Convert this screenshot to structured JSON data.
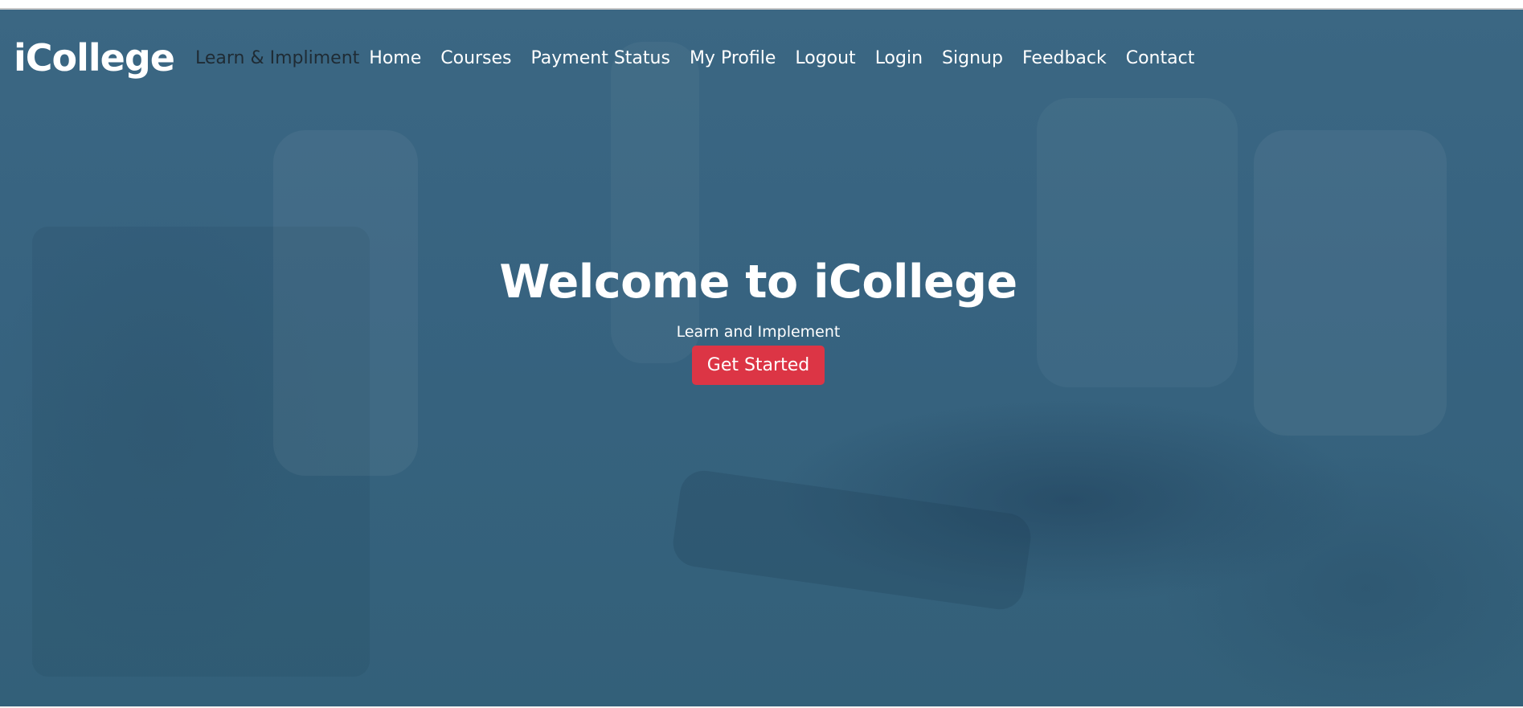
{
  "navbar": {
    "brand": "iCollege",
    "tagline": "Learn & Impliment",
    "links": [
      {
        "label": "Home"
      },
      {
        "label": "Courses"
      },
      {
        "label": "Payment Status"
      },
      {
        "label": "My Profile"
      },
      {
        "label": "Logout"
      },
      {
        "label": "Login"
      },
      {
        "label": "Signup"
      },
      {
        "label": "Feedback"
      },
      {
        "label": "Contact"
      }
    ]
  },
  "hero": {
    "title": "Welcome to iCollege",
    "subtitle": "Learn and Implement",
    "cta_label": "Get Started"
  },
  "colors": {
    "hero_overlay": "#376380",
    "cta_background": "#dc3545",
    "tagline_text": "#1f2b34"
  }
}
